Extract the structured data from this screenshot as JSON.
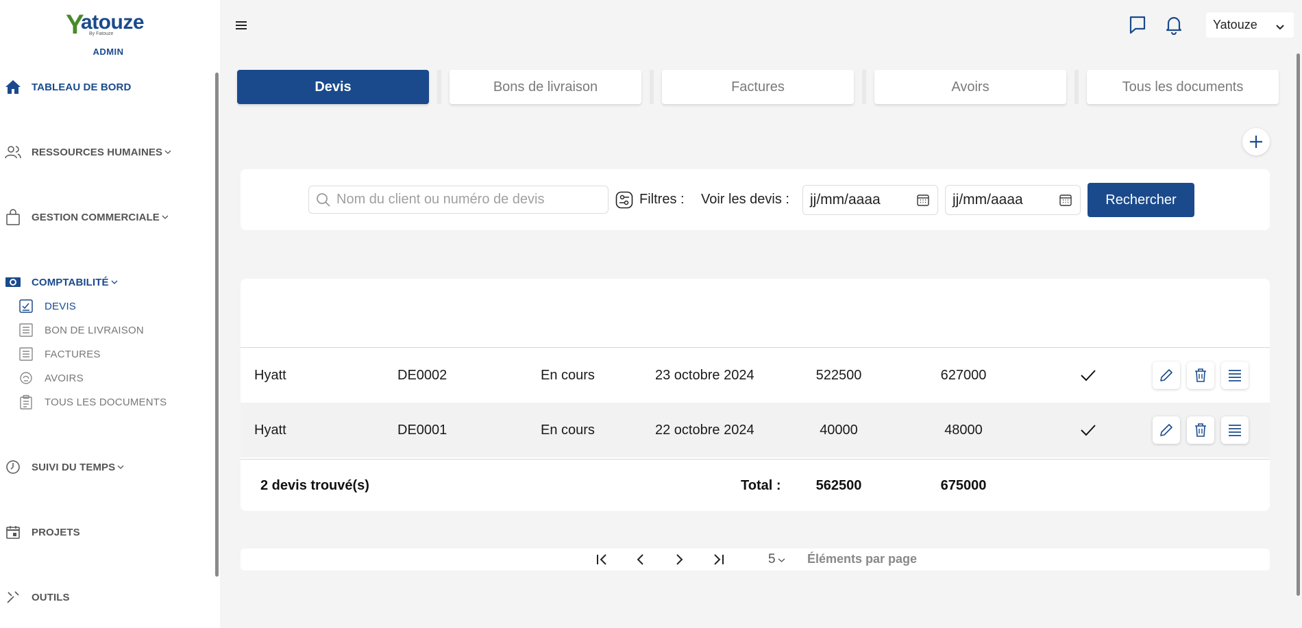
{
  "brand": {
    "name": "atouze",
    "initial": "Y",
    "tagline": "By Fatouze",
    "role": "ADMIN"
  },
  "sidebar": {
    "items": [
      {
        "label": "TABLEAU DE BORD",
        "icon": "home-icon"
      },
      {
        "label": "RESSOURCES HUMAINES",
        "icon": "users-icon"
      },
      {
        "label": "GESTION COMMERCIALE",
        "icon": "shopping-bag-icon"
      },
      {
        "label": "COMPTABILITÉ",
        "icon": "cash-icon"
      },
      {
        "label": "SUIVI DU TEMPS",
        "icon": "clock-icon"
      },
      {
        "label": "PROJETS",
        "icon": "calendar-icon"
      },
      {
        "label": "OUTILS",
        "icon": "tools-icon"
      }
    ],
    "sub_items": [
      {
        "label": "DEVIS",
        "icon": "quote-icon"
      },
      {
        "label": "BON DE LIVRAISON",
        "icon": "document-icon"
      },
      {
        "label": "FACTURES",
        "icon": "document-icon"
      },
      {
        "label": "AVOIRS",
        "icon": "credit-note-icon"
      },
      {
        "label": "TOUS LES DOCUMENTS",
        "icon": "clipboard-icon"
      }
    ]
  },
  "header": {
    "user": "Yatouze"
  },
  "tabs": [
    "Devis",
    "Bons de livraison",
    "Factures",
    "Avoirs",
    "Tous les documents"
  ],
  "filters": {
    "search_placeholder": "Nom du client ou numéro de devis",
    "filters_label": "Filtres :",
    "see_label": "Voir les devis :",
    "date_from_placeholder": "jj/mm/aaaa",
    "date_to_placeholder": "jj/mm/aaaa",
    "search_button": "Rechercher"
  },
  "table": {
    "rows": [
      {
        "client": "Hyatt",
        "number": "DE0002",
        "status": "En cours",
        "date": "23 octobre 2024",
        "amount_ht": "522500",
        "amount_ttc": "627000"
      },
      {
        "client": "Hyatt",
        "number": "DE0001",
        "status": "En cours",
        "date": "22 octobre 2024",
        "amount_ht": "40000",
        "amount_ttc": "48000"
      }
    ],
    "footer": {
      "count_label": "2 devis trouvé(s)",
      "total_label": "Total :",
      "total_ht": "562500",
      "total_ttc": "675000"
    }
  },
  "pagination": {
    "page_size": "5",
    "page_size_label": "Éléments par page"
  },
  "colors": {
    "primary": "#1a4a8c",
    "logo_green": "#4a8a2a",
    "background": "#f4f4f4"
  }
}
